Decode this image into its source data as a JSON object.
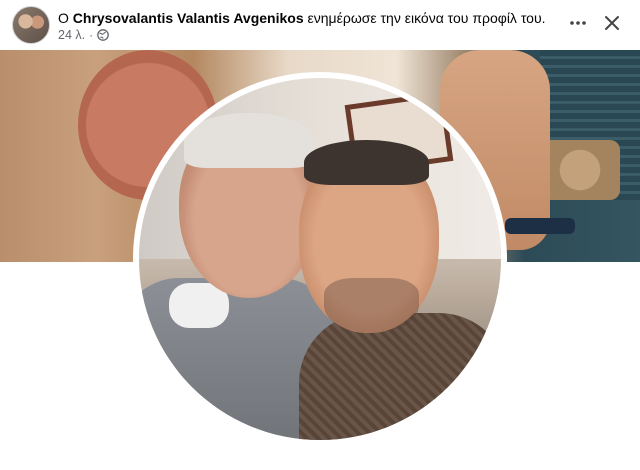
{
  "post": {
    "prefix": "Ο",
    "author": "Chrysovalantis Valantis Avgenikos",
    "action": "ενημέρωσε την εικόνα του προφίλ του.",
    "time": "24 λ.",
    "separator": "·",
    "audience_icon": "globe-icon"
  },
  "toolbar": {
    "more_icon": "more-horizontal-icon",
    "close_icon": "close-icon"
  },
  "colors": {
    "text_primary": "#050505",
    "text_secondary": "#65676b"
  }
}
